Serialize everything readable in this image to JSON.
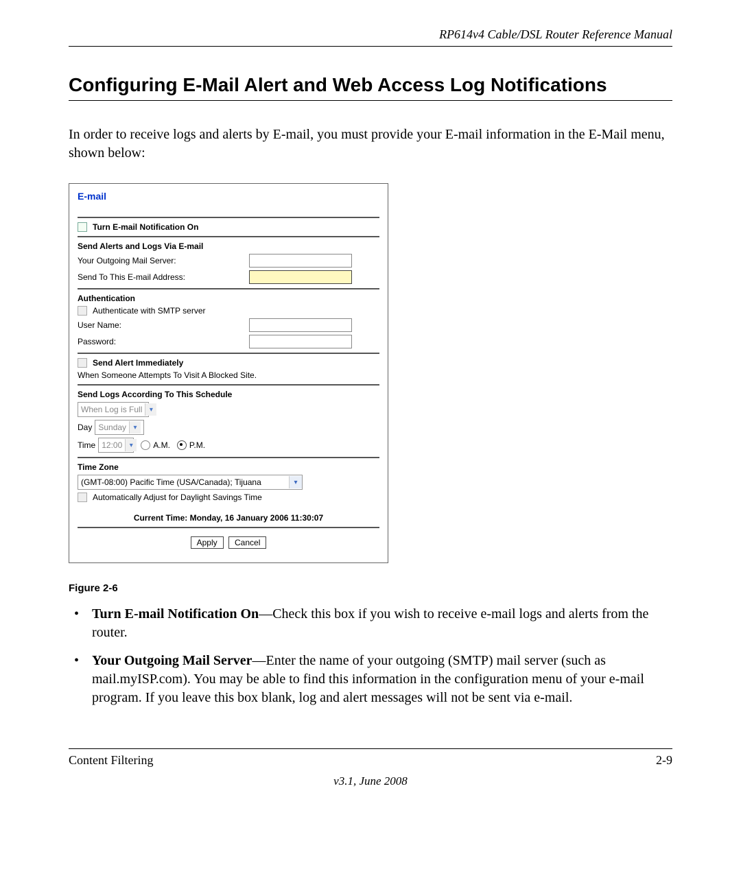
{
  "header": {
    "doc_title": "RP614v4 Cable/DSL Router Reference Manual"
  },
  "section": {
    "title": "Configuring E-Mail Alert and Web Access Log Notifications",
    "intro": "In order to receive logs and alerts by E-mail, you must provide your E-mail information in the E-Mail menu, shown below:"
  },
  "panel": {
    "title": "E-mail",
    "turn_on_label": "Turn E-mail Notification On",
    "send_section_label": "Send Alerts and Logs Via E-mail",
    "outgoing_label": "Your Outgoing Mail Server:",
    "sendto_label": "Send To This E-mail Address:",
    "auth_section_label": "Authentication",
    "auth_checkbox_label": "Authenticate with SMTP server",
    "username_label": "User Name:",
    "password_label": "Password:",
    "alert_immediate_label": "Send Alert Immediately",
    "alert_sub_label": "When Someone Attempts To Visit A Blocked Site.",
    "schedule_label": "Send Logs According To This Schedule",
    "schedule_value": "When Log is Full",
    "day_label": "Day",
    "day_value": "Sunday",
    "time_label": "Time",
    "time_value": "12:00",
    "am_label": "A.M.",
    "pm_label": "P.M.",
    "timezone_section_label": "Time Zone",
    "timezone_value": "(GMT-08:00) Pacific Time (USA/Canada); Tijuana",
    "dst_label": "Automatically Adjust for Daylight Savings Time",
    "current_time": "Current Time: Monday, 16 January 2006 11:30:07",
    "apply_label": "Apply",
    "cancel_label": "Cancel"
  },
  "figure": {
    "caption": "Figure 2-6"
  },
  "bullets": {
    "b1_bold": "Turn E-mail Notification On",
    "b1_rest": "—Check this box if you wish to receive e-mail logs and alerts from the router.",
    "b2_bold": "Your Outgoing Mail Server",
    "b2_rest": "—Enter the name of your outgoing (SMTP) mail server (such as mail.myISP.com). You may be able to find this information in the configuration menu of your e-mail program. If you leave this box blank, log and alert messages will not be sent via e-mail."
  },
  "footer": {
    "section_name": "Content Filtering",
    "page_num": "2-9",
    "version": "v3.1, June 2008"
  }
}
